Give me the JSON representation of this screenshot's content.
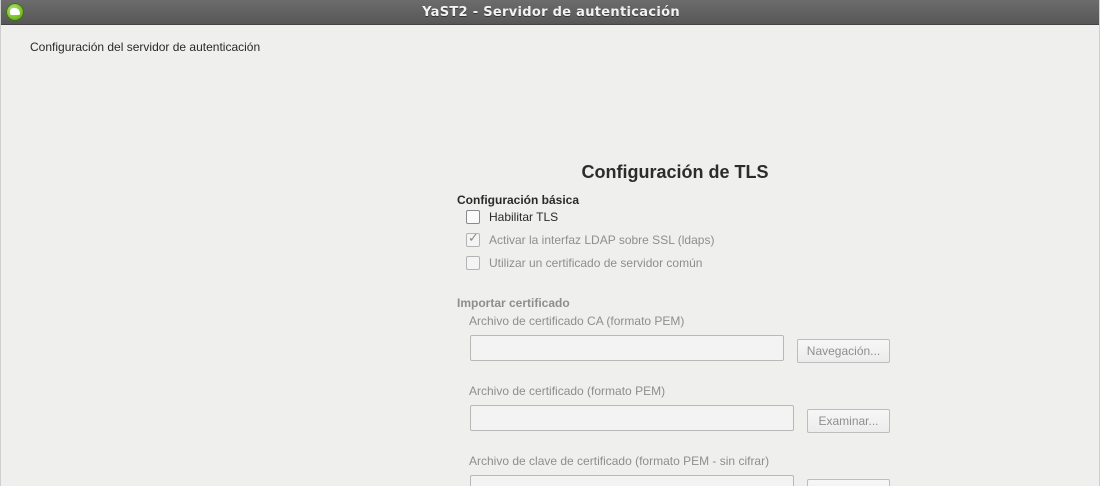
{
  "window": {
    "title": "YaST2 - Servidor de autenticación",
    "app_icon": "yast-icon"
  },
  "page": {
    "subtitle": "Configuración del servidor de autenticación",
    "heading": "Configuración de TLS"
  },
  "basic": {
    "label": "Configuración básica",
    "options": [
      {
        "label": "Habilitar TLS",
        "checked": false,
        "enabled": true
      },
      {
        "label": "Activar la interfaz LDAP sobre SSL (ldaps)",
        "checked": true,
        "enabled": false
      },
      {
        "label": "Utilizar un certificado de servidor común",
        "checked": false,
        "enabled": false
      }
    ]
  },
  "import": {
    "label": "Importar certificado",
    "fields": [
      {
        "label": "Archivo de certificado CA (formato PEM)",
        "value": "",
        "button": "Navegación..."
      },
      {
        "label": "Archivo de certificado (formato PEM)",
        "value": "",
        "button": "Examinar..."
      },
      {
        "label": "Archivo de clave de certificado (formato PEM - sin cifrar)",
        "value": "",
        "button": ""
      }
    ]
  }
}
